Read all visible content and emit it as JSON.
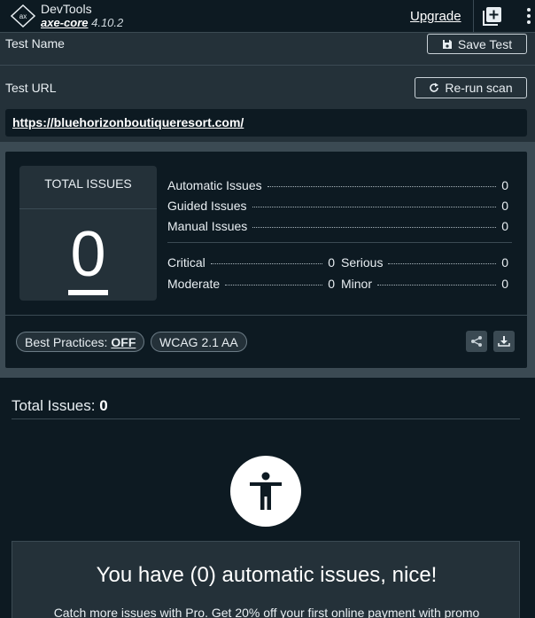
{
  "header": {
    "brand_title": "DevTools",
    "brand_product": "axe-core",
    "brand_version": "4.10.2",
    "upgrade_label": "Upgrade"
  },
  "test": {
    "name_label": "Test Name",
    "save_label": "Save Test",
    "url_label": "Test URL",
    "rerun_label": "Re-run scan",
    "url_value": "https://bluehorizonboutiqueresort.com/"
  },
  "summary": {
    "total_label": "TOTAL ISSUES",
    "total_value": "0",
    "automatic_label": "Automatic Issues",
    "automatic_value": "0",
    "guided_label": "Guided Issues",
    "guided_value": "0",
    "manual_label": "Manual Issues",
    "manual_value": "0",
    "critical_label": "Critical",
    "critical_value": "0",
    "serious_label": "Serious",
    "serious_value": "0",
    "moderate_label": "Moderate",
    "moderate_value": "0",
    "minor_label": "Minor",
    "minor_value": "0",
    "best_practices_label": "Best Practices:",
    "best_practices_value": "OFF",
    "standard_label": "WCAG 2.1 AA"
  },
  "results": {
    "title_label": "Total Issues:",
    "title_value": "0",
    "nice_title": "You have (0) automatic issues, nice!",
    "nice_sub": "Catch more issues with Pro. Get 20% off your first online payment with promo"
  },
  "colors": {
    "background": "#0d1a22",
    "panel": "#243139",
    "border": "#3b4a53"
  }
}
